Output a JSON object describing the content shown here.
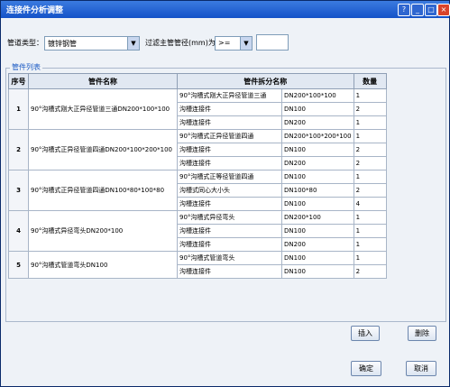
{
  "window": {
    "title": "连接件分析调整"
  },
  "filters": {
    "pipe_type_label": "管道类型：",
    "pipe_type_value": "镀锌钢管",
    "filter_label": "过滤主管管径(mm)为：",
    "operator_value": ">=",
    "diameter_value": ""
  },
  "group_title": "管件列表",
  "table": {
    "headers": {
      "index": "序号",
      "fitting": "管件名称",
      "split": "管件拆分名称",
      "qty": "数量"
    },
    "rows": [
      {
        "index": "1",
        "fitting": "90°沟槽式刚大正异径管道三通DN200*100*100",
        "parts": [
          {
            "name": "90°沟槽式刚大正异径管道三通",
            "spec": "DN200*100*100",
            "qty": "1"
          },
          {
            "name": "沟槽连接件",
            "spec": "DN100",
            "qty": "2"
          },
          {
            "name": "沟槽连接件",
            "spec": "DN200",
            "qty": "1"
          }
        ]
      },
      {
        "index": "2",
        "fitting": "90°沟槽式正异径管道四通DN200*100*200*100",
        "parts": [
          {
            "name": "90°沟槽式正异径管道四通",
            "spec": "DN200*100*200*100",
            "qty": "1"
          },
          {
            "name": "沟槽连接件",
            "spec": "DN100",
            "qty": "2"
          },
          {
            "name": "沟槽连接件",
            "spec": "DN200",
            "qty": "2"
          }
        ]
      },
      {
        "index": "3",
        "fitting": "90°沟槽式正异径管道四通DN100*80*100*80",
        "parts": [
          {
            "name": "90°沟槽式正等径管道四通",
            "spec": "DN100",
            "qty": "1"
          },
          {
            "name": "沟槽式同心大小头",
            "spec": "DN100*80",
            "qty": "2"
          },
          {
            "name": "沟槽连接件",
            "spec": "DN100",
            "qty": "4"
          }
        ]
      },
      {
        "index": "4",
        "fitting": "90°沟槽式异径弯头DN200*100",
        "parts": [
          {
            "name": "90°沟槽式异径弯头",
            "spec": "DN200*100",
            "qty": "1"
          },
          {
            "name": "沟槽连接件",
            "spec": "DN100",
            "qty": "1"
          },
          {
            "name": "沟槽连接件",
            "spec": "DN200",
            "qty": "1"
          }
        ]
      },
      {
        "index": "5",
        "fitting": "90°沟槽式管道弯头DN100",
        "parts": [
          {
            "name": "90°沟槽式管道弯头",
            "spec": "DN100",
            "qty": "1"
          },
          {
            "name": "沟槽连接件",
            "spec": "DN100",
            "qty": "2"
          }
        ]
      }
    ]
  },
  "buttons": {
    "insert": "插入",
    "delete": "删除",
    "ok": "确定",
    "cancel": "取消"
  }
}
